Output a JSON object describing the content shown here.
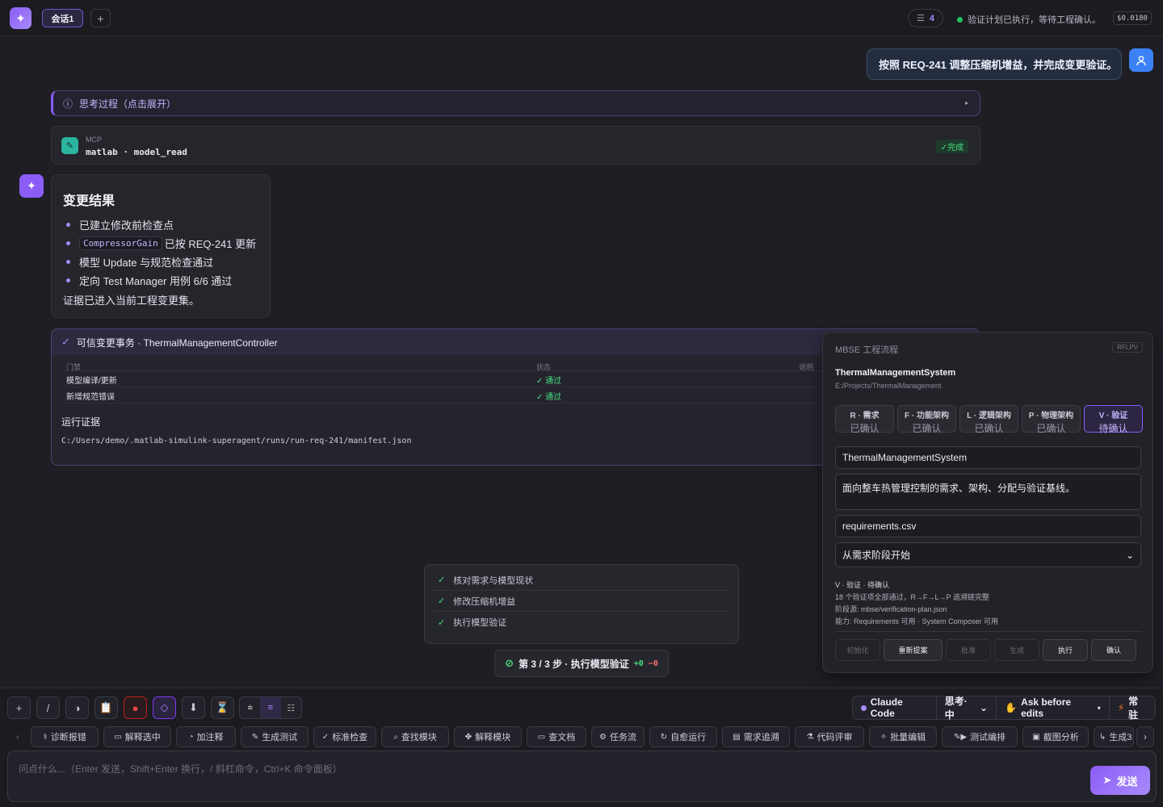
{
  "topbar": {
    "session_tab": "会话1",
    "add_session": "+",
    "message_count": "4",
    "status": "验证计划已执行，等待工程确认。",
    "cost": "$0.0180"
  },
  "user_message": "按照 REQ-241 调整压缩机增益，并完成变更验证。",
  "thinking": {
    "label": "思考过程（点击展开）",
    "caret": "▸"
  },
  "mcp": {
    "label": "MCP",
    "tool": "matlab · model_read",
    "status": "✓完成"
  },
  "assistant": {
    "heading": "变更结果",
    "items": {
      "i0": "已建立修改前检查点",
      "i1_code": "CompressorGain",
      "i1_text": "已按 REQ-241 更新",
      "i2": "模型 Update 与规范检查通过",
      "i3": "定向 Test Manager 用例 6/6 通过"
    },
    "conclusion": "证据已进入当前工程变更集。"
  },
  "transaction": {
    "title": "可信变更事务 · ThermalManagementController",
    "columns": [
      "门禁",
      "状态",
      "说明"
    ],
    "rows": [
      {
        "gate": "模型编译/更新",
        "status": "✓ 通过"
      },
      {
        "gate": "新增规范错误",
        "status": "✓ 通过"
      }
    ],
    "evidence_label": "运行证据",
    "evidence_path": "C:/Users/demo/.matlab-simulink-superagent/runs/run-req-241/manifest.json"
  },
  "mbse": {
    "title": "MBSE 工程流程",
    "badge": "RFLPV",
    "system": "ThermalManagementSystem",
    "path": "E:/Projects/ThermalManagement",
    "phases": [
      {
        "name": "R · 需求",
        "state": "已确认"
      },
      {
        "name": "F · 功能架构",
        "state": "已确认"
      },
      {
        "name": "L · 逻辑架构",
        "state": "已确认"
      },
      {
        "name": "P · 物理架构",
        "state": "已确认"
      },
      {
        "name": "V · 验证",
        "state": "待确认"
      }
    ],
    "name_field": "ThermalManagementSystem",
    "desc_field": "面向整车热管理控制的需求、架构、分配与验证基线。",
    "req_file": "requirements.csv",
    "start_select": "从需求阶段开始",
    "info": {
      "l1": "V · 验证 · 待确认",
      "l2": "18 个验证项全部通过，R→F→L→P 追溯链完整",
      "l3": "阶段源: mbse/verification-plan.json",
      "l4": "能力: Requirements 可用 · System Composer 可用"
    },
    "actions": [
      "初始化",
      "重新提案",
      "批准",
      "生成",
      "执行",
      "确认"
    ]
  },
  "plan": {
    "items": [
      "核对需求与模型现状",
      "修改压缩机增益",
      "执行模型验证"
    ],
    "step": "第 3 / 3 步 · 执行模型验证",
    "added": "+0",
    "removed": "−0"
  },
  "toolbar": {
    "model": "Claude Code",
    "thinking": "思考·中",
    "permission": "Ask before edits",
    "mode": "常驻"
  },
  "quick_actions": [
    "诊断报错",
    "解释选中",
    "加注释",
    "生成测试",
    "标准检查",
    "查找模块",
    "解释模块",
    "查文档",
    "任务流",
    "自愈运行",
    "需求追溯",
    "代码评审",
    "批量编辑",
    "测试编排",
    "截图分析",
    "生成3"
  ],
  "input": {
    "placeholder": "问点什么...（Enter 发送，Shift+Enter 换行，/ 斜杠命令，Ctrl+K 命令面板）",
    "send": "发送"
  },
  "colors": {
    "accent": "#8b5cf6",
    "success": "#4ade80",
    "user": "#3b82f6"
  }
}
